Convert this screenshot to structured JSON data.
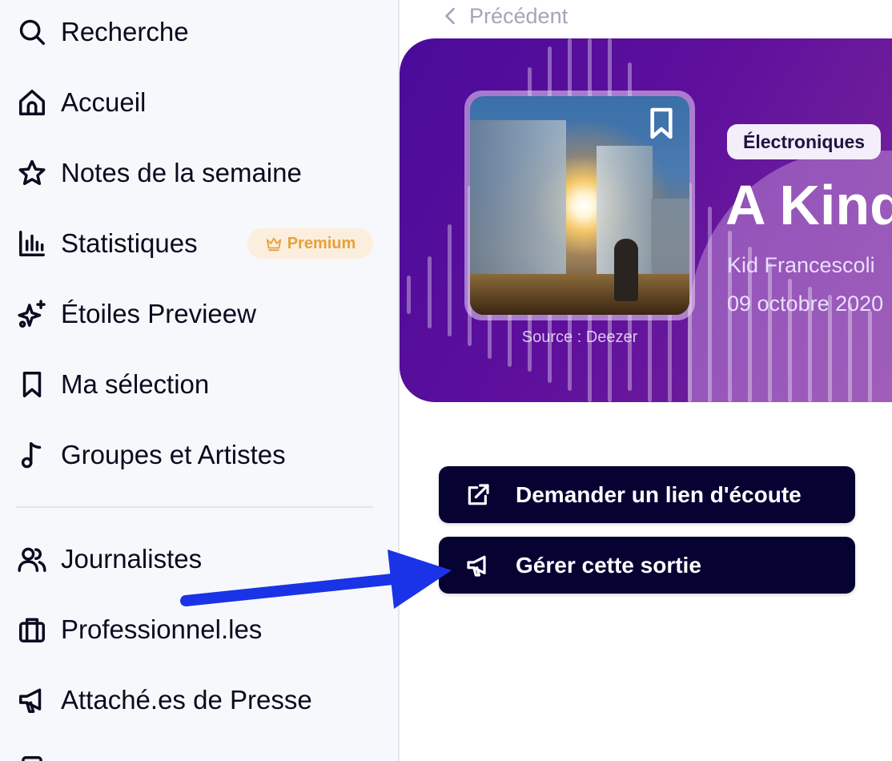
{
  "sidebar": {
    "items": [
      {
        "label": "Recherche",
        "icon": "search-icon"
      },
      {
        "label": "Accueil",
        "icon": "home-icon"
      },
      {
        "label": "Notes de la semaine",
        "icon": "star-icon"
      },
      {
        "label": "Statistiques",
        "icon": "bar-chart-icon"
      },
      {
        "label": "Étoiles Previeew",
        "icon": "sparkles-icon"
      },
      {
        "label": "Ma sélection",
        "icon": "bookmark-icon"
      },
      {
        "label": "Groupes et Artistes",
        "icon": "music-note-icon"
      },
      {
        "label": "Journalistes",
        "icon": "users-icon"
      },
      {
        "label": "Professionnel.les",
        "icon": "briefcase-icon"
      },
      {
        "label": "Attaché.es de Presse",
        "icon": "megaphone-icon"
      }
    ],
    "premium_badge": "Premium"
  },
  "main": {
    "back_label": "Précédent",
    "hero": {
      "cover_source": "Source : Deezer",
      "genre": "Électroniques",
      "title": "A Kind",
      "artist": "Kid Francescoli",
      "date": "09 octobre 2020"
    },
    "actions": {
      "listen_link_label": "Demander un lien d'écoute",
      "manage_release_label": "Gérer cette sortie"
    }
  },
  "colors": {
    "button_bg": "#060333",
    "hero_gradient_start": "#4a0b9a",
    "hero_gradient_end": "#7a2a9a",
    "premium_text": "#e8a13a",
    "annotation_arrow": "#1a33e6"
  }
}
